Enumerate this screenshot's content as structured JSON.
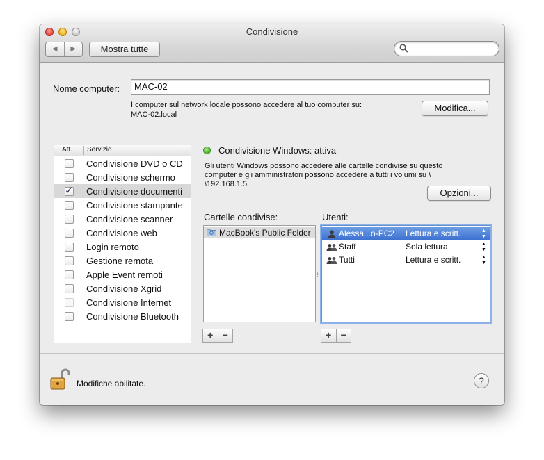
{
  "window": {
    "title": "Condivisione"
  },
  "toolbar": {
    "back_glyph": "◀",
    "forward_glyph": "▶",
    "show_all_label": "Mostra tutte",
    "search_placeholder": ""
  },
  "computer_name": {
    "label": "Nome computer:",
    "value": "MAC-02",
    "info_line1": "I computer sul network locale possono accedere al tuo computer su:",
    "info_line2": "MAC-02.local",
    "edit_button": "Modifica..."
  },
  "services": {
    "col_on": "Att.",
    "col_service": "Servizio",
    "items": [
      {
        "name": "Condivisione DVD o CD",
        "checked": false,
        "enabled": true
      },
      {
        "name": "Condivisione schermo",
        "checked": false,
        "enabled": true
      },
      {
        "name": "Condivisione documenti",
        "checked": true,
        "enabled": true,
        "selected": true
      },
      {
        "name": "Condivisione stampante",
        "checked": false,
        "enabled": true
      },
      {
        "name": "Condivisione scanner",
        "checked": false,
        "enabled": true
      },
      {
        "name": "Condivisione web",
        "checked": false,
        "enabled": true
      },
      {
        "name": "Login remoto",
        "checked": false,
        "enabled": true
      },
      {
        "name": "Gestione remota",
        "checked": false,
        "enabled": true
      },
      {
        "name": "Apple Event remoti",
        "checked": false,
        "enabled": true
      },
      {
        "name": "Condivisione Xgrid",
        "checked": false,
        "enabled": true
      },
      {
        "name": "Condivisione Internet",
        "checked": false,
        "enabled": false
      },
      {
        "name": "Condivisione Bluetooth",
        "checked": false,
        "enabled": true
      }
    ]
  },
  "detail": {
    "status": "Condivisione Windows: attiva",
    "status_color": "#3fae1f",
    "description": "Gli utenti Windows possono accedere alle cartelle condivise su questo computer e gli amministratori possono accedere a tutti i volumi su \\ \\192.168.1.5.",
    "options_button": "Opzioni..."
  },
  "shared_folders": {
    "label": "Cartelle condivise:",
    "items": [
      {
        "name": "MacBook's Public Folder",
        "selected": true
      }
    ],
    "add": "+",
    "remove": "−"
  },
  "users": {
    "label": "Utenti:",
    "items": [
      {
        "name": "Alessa...o-PC2",
        "permission": "Lettura e scritt.",
        "selected": true,
        "icon": "single-user-icon"
      },
      {
        "name": "Staff",
        "permission": "Sola lettura",
        "selected": false,
        "icon": "group-icon"
      },
      {
        "name": "Tutti",
        "permission": "Lettura e scritt.",
        "selected": false,
        "icon": "group-icon"
      }
    ],
    "stepper_up": "▲",
    "stepper_down": "▼",
    "add": "+",
    "remove": "−"
  },
  "footer": {
    "lock_text": "Modifiche abilitate.",
    "help": "?"
  }
}
